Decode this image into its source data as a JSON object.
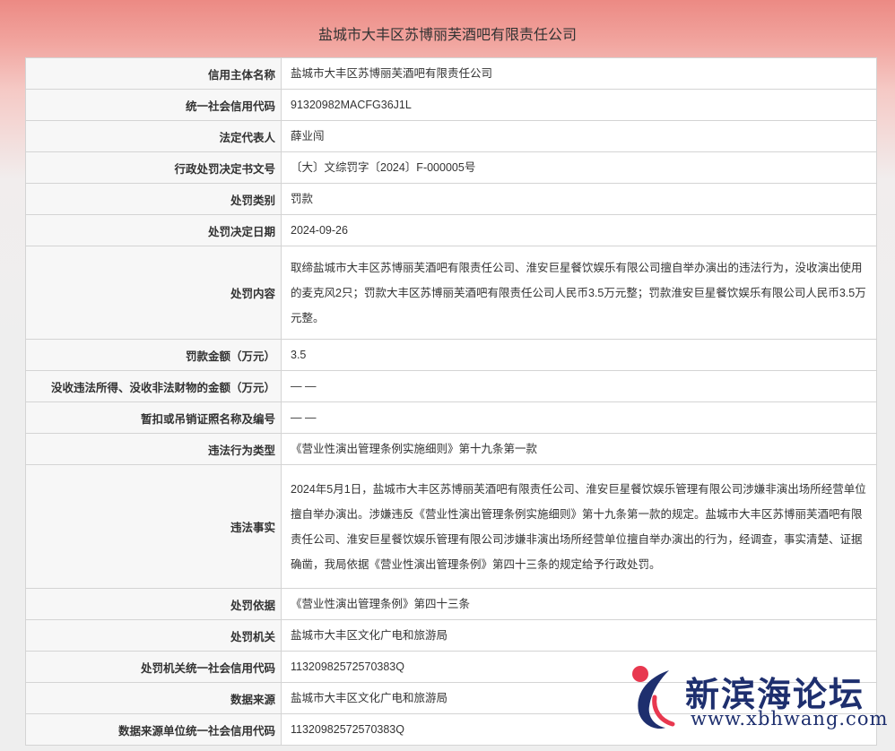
{
  "title": "盐城市大丰区苏博丽芙酒吧有限责任公司",
  "rows": [
    {
      "label": "信用主体名称",
      "value": "盐城市大丰区苏博丽芙酒吧有限责任公司"
    },
    {
      "label": "统一社会信用代码",
      "value": "91320982MACFG36J1L"
    },
    {
      "label": "法定代表人",
      "value": "薛业闯"
    },
    {
      "label": "行政处罚决定书文号",
      "value": "〔大〕文综罚字〔2024〕F-000005号"
    },
    {
      "label": "处罚类别",
      "value": "罚款"
    },
    {
      "label": "处罚决定日期",
      "value": "2024-09-26"
    },
    {
      "label": "处罚内容",
      "value": "取缔盐城市大丰区苏博丽芙酒吧有限责任公司、淮安巨星餐饮娱乐有限公司擅自举办演出的违法行为，没收演出使用的麦克风2只；罚款大丰区苏博丽芙酒吧有限责任公司人民币3.5万元整；罚款淮安巨星餐饮娱乐有限公司人民币3.5万元整。"
    },
    {
      "label": "罚款金额（万元）",
      "value": "3.5"
    },
    {
      "label": "没收违法所得、没收非法财物的金额（万元）",
      "value": "— —"
    },
    {
      "label": "暂扣或吊销证照名称及编号",
      "value": "— —"
    },
    {
      "label": "违法行为类型",
      "value": "《营业性演出管理条例实施细则》第十九条第一款"
    },
    {
      "label": "违法事实",
      "value": "2024年5月1日，盐城市大丰区苏博丽芙酒吧有限责任公司、淮安巨星餐饮娱乐管理有限公司涉嫌非演出场所经营单位擅自举办演出。涉嫌违反《营业性演出管理条例实施细则》第十九条第一款的规定。盐城市大丰区苏博丽芙酒吧有限责任公司、淮安巨星餐饮娱乐管理有限公司涉嫌非演出场所经营单位擅自举办演出的行为，经调查，事实清楚、证据确凿，我局依据《营业性演出管理条例》第四十三条的规定给予行政处罚。"
    },
    {
      "label": "处罚依据",
      "value": "《营业性演出管理条例》第四十三条"
    },
    {
      "label": "处罚机关",
      "value": "盐城市大丰区文化广电和旅游局"
    },
    {
      "label": "处罚机关统一社会信用代码",
      "value": "11320982572570383Q"
    },
    {
      "label": "数据来源",
      "value": "盐城市大丰区文化广电和旅游局"
    },
    {
      "label": "数据来源单位统一社会信用代码",
      "value": "11320982572570383Q"
    }
  ],
  "watermark": {
    "title": "新滨海论坛",
    "url": "www.xbhwang.com",
    "accent": "#e8384f",
    "blue": "#1e2f6e"
  }
}
